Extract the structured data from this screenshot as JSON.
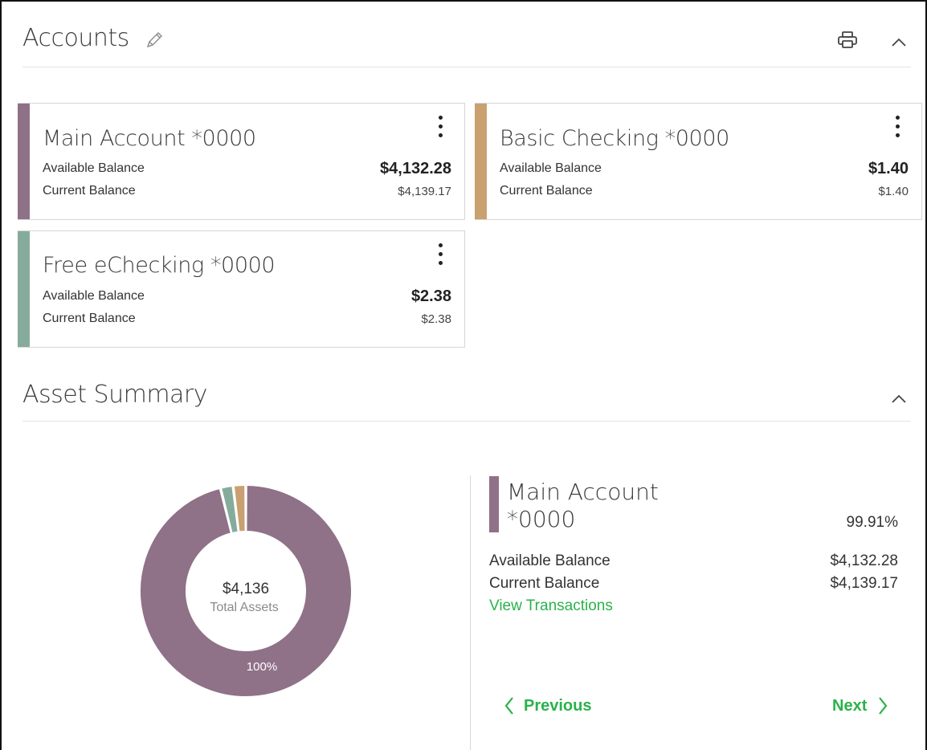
{
  "accounts_section": {
    "title": "Accounts",
    "edit_icon": "pencil-icon",
    "print_icon": "printer-icon",
    "collapse_icon": "chevron-up-icon"
  },
  "labels": {
    "available": "Available Balance",
    "current": "Current Balance"
  },
  "accounts": [
    {
      "name": "Main Account *0000",
      "available": "$4,132.28",
      "current": "$4,139.17",
      "color": "#8f7188"
    },
    {
      "name": "Basic Checking *0000",
      "available": "$1.40",
      "current": "$1.40",
      "color": "#c9a06f"
    },
    {
      "name": "Free eChecking *0000",
      "available": "$2.38",
      "current": "$2.38",
      "color": "#86ab9c"
    }
  ],
  "asset_summary": {
    "title": "Asset Summary",
    "collapse_icon": "chevron-up-icon",
    "total_value": "$4,136",
    "total_label": "Total Assets",
    "slice_label": "100%",
    "chart_data": {
      "type": "pie",
      "categories": [
        "Main Account *0000",
        "Basic Checking *0000",
        "Free eChecking *0000"
      ],
      "values": [
        4132.28,
        1.4,
        2.38
      ],
      "colors": [
        "#8f7188",
        "#c9a06f",
        "#86ab9c"
      ]
    },
    "detail": {
      "name_line1": "Main Account",
      "name_line2": "*0000",
      "percent": "99.91%",
      "available_label": "Available Balance",
      "available_value": "$4,132.28",
      "current_label": "Current Balance",
      "current_value": "$4,139.17",
      "link": "View Transactions",
      "color": "#8f7188"
    },
    "prev_label": "Previous",
    "next_label": "Next"
  }
}
